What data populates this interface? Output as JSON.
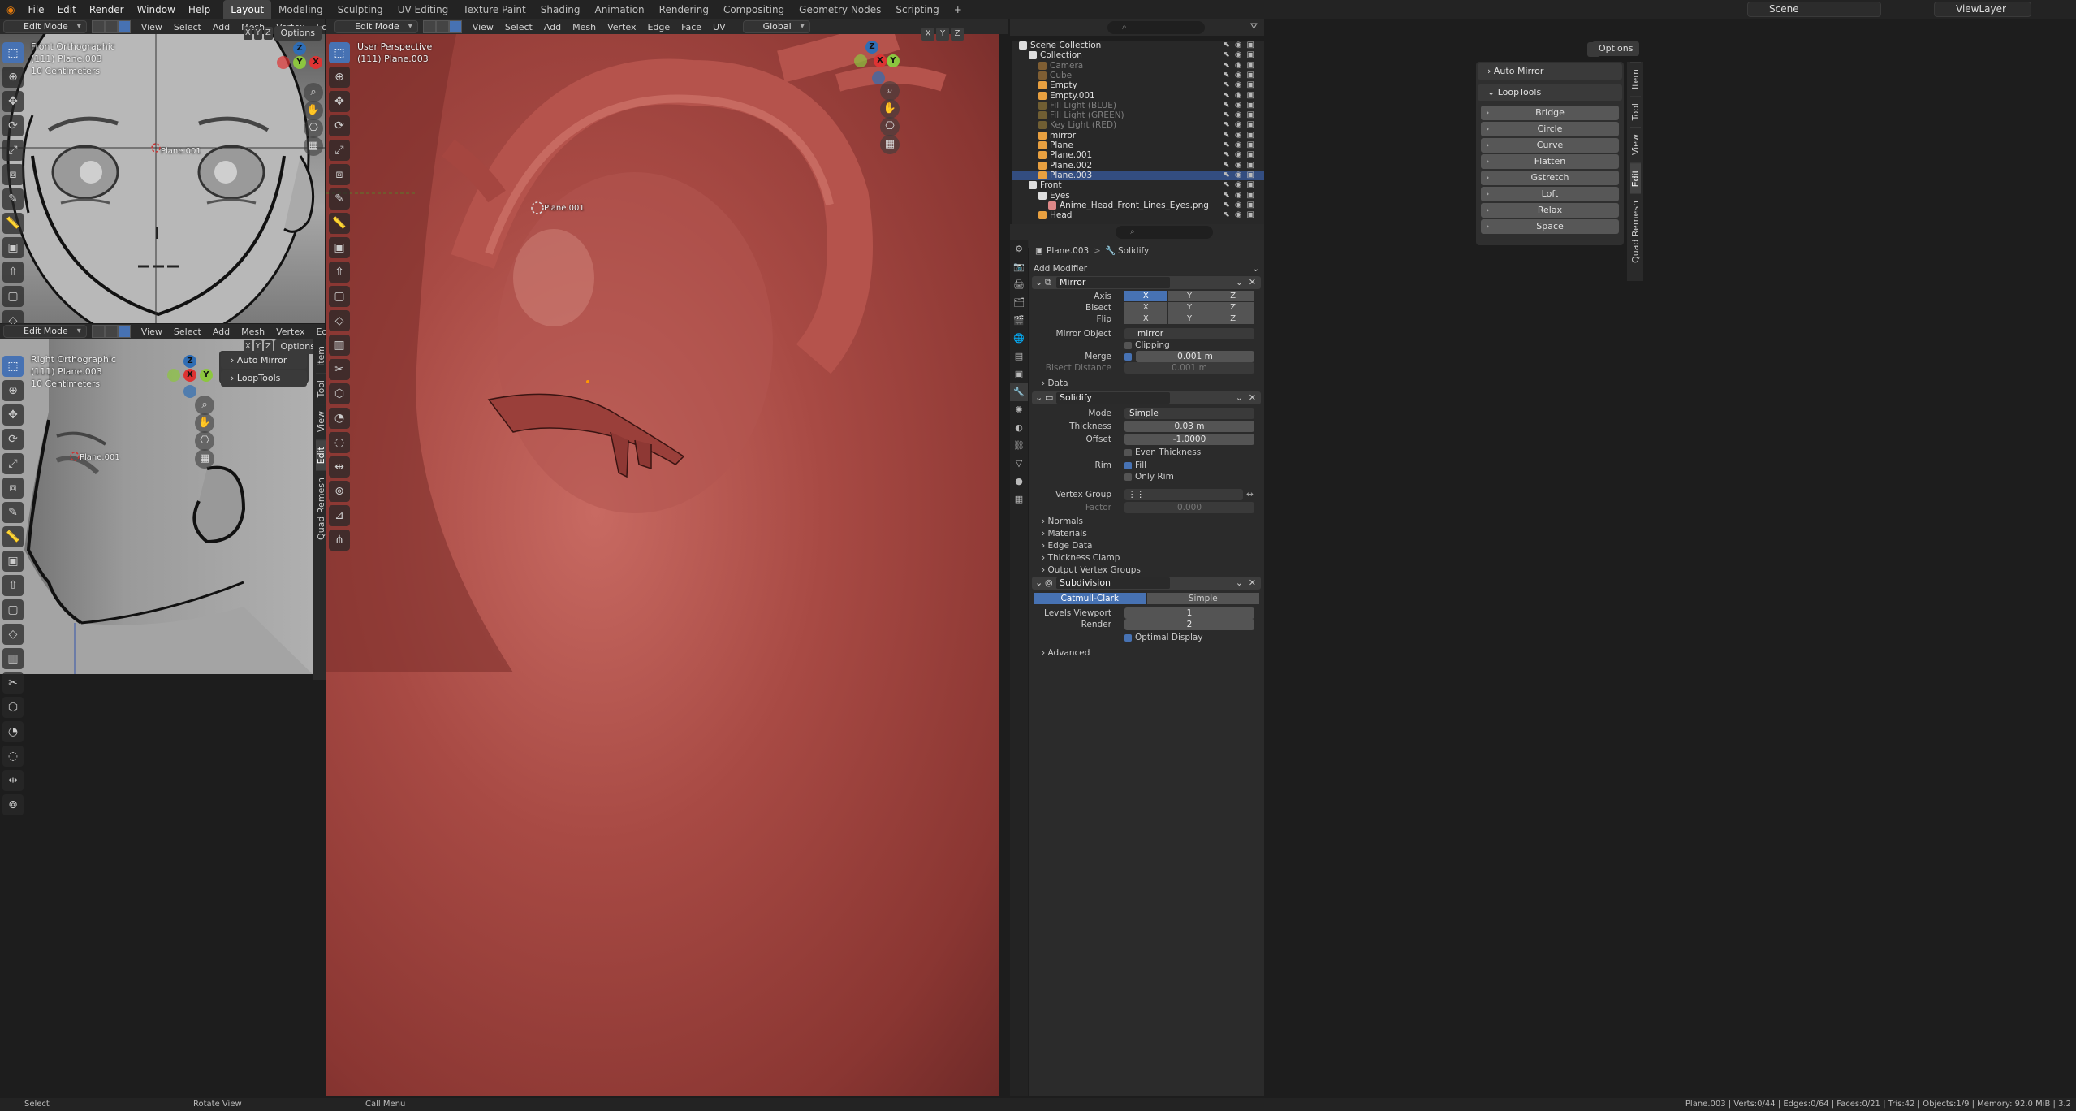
{
  "topbar": {
    "menus": [
      "File",
      "Edit",
      "Render",
      "Window",
      "Help"
    ],
    "workspaces": [
      "Layout",
      "Modeling",
      "Sculpting",
      "UV Editing",
      "Texture Paint",
      "Shading",
      "Animation",
      "Rendering",
      "Compositing",
      "Geometry Nodes",
      "Scripting"
    ],
    "active_workspace": "Layout",
    "add_tab": "+",
    "scene": "Scene",
    "view_layer": "ViewLayer"
  },
  "viewport_header": {
    "mode": "Edit Mode",
    "menus_full": [
      "View",
      "Select",
      "Add",
      "Mesh",
      "Vertex",
      "Edge",
      "Face",
      "UV"
    ],
    "transform": "Global",
    "options": "Options",
    "axes": [
      "X",
      "Y",
      "Z"
    ]
  },
  "viewport_front": {
    "line1": "Front Orthographic",
    "line2": "(111) Plane.003",
    "line3": "10 Centimeters",
    "cursor_label": "Plane.001",
    "gizmo": {
      "z": "Z",
      "y": "Y",
      "x": "X"
    }
  },
  "viewport_right": {
    "line1": "Right Orthographic",
    "line2": "(111) Plane.003",
    "line3": "10 Centimeters",
    "cursor_label": "Plane.001",
    "panel_auto_mirror": "Auto Mirror",
    "panel_looptools": "LoopTools",
    "gizmo": {
      "z": "Z",
      "y": "Y",
      "x": "X"
    }
  },
  "viewport_main": {
    "line1": "User Perspective",
    "line2": "(111) Plane.003",
    "cursor_label": "Plane.001",
    "panel_auto_mirror": "Auto Mirror",
    "panel_looptools": "LoopTools",
    "looptools_buttons": [
      "Bridge",
      "Circle",
      "Curve",
      "Flatten",
      "Gstretch",
      "Loft",
      "Relax",
      "Space"
    ],
    "gizmo": {
      "z": "Z",
      "y": "Y",
      "x": "X"
    }
  },
  "side_tabs": [
    "Item",
    "Tool",
    "View",
    "Edit",
    "Quad Remesh"
  ],
  "outliner": {
    "rows": [
      {
        "label": "Scene Collection",
        "indent": 0,
        "state": "normal"
      },
      {
        "label": "Collection",
        "indent": 1,
        "state": "normal"
      },
      {
        "label": "Camera",
        "indent": 2,
        "state": "dim"
      },
      {
        "label": "Cube",
        "indent": 2,
        "state": "dim"
      },
      {
        "label": "Empty",
        "indent": 2,
        "state": "normal"
      },
      {
        "label": "Empty.001",
        "indent": 2,
        "state": "normal"
      },
      {
        "label": "Fill Light (BLUE)",
        "indent": 2,
        "state": "dim"
      },
      {
        "label": "Fill Light (GREEN)",
        "indent": 2,
        "state": "dim"
      },
      {
        "label": "Key Light (RED)",
        "indent": 2,
        "state": "dim"
      },
      {
        "label": "mirror",
        "indent": 2,
        "state": "normal"
      },
      {
        "label": "Plane",
        "indent": 2,
        "state": "normal"
      },
      {
        "label": "Plane.001",
        "indent": 2,
        "state": "normal"
      },
      {
        "label": "Plane.002",
        "indent": 2,
        "state": "normal"
      },
      {
        "label": "Plane.003",
        "indent": 2,
        "state": "selected"
      },
      {
        "label": "Front",
        "indent": 1,
        "state": "normal"
      },
      {
        "label": "Eyes",
        "indent": 2,
        "state": "normal"
      },
      {
        "label": "Anime_Head_Front_Lines_Eyes.png",
        "indent": 3,
        "state": "normal"
      },
      {
        "label": "Head",
        "indent": 2,
        "state": "normal"
      }
    ]
  },
  "properties": {
    "breadcrumb_object": "Plane.003",
    "breadcrumb_sep": ">",
    "breadcrumb_modifier": "Solidify",
    "add_modifier": "Add Modifier",
    "mirror": {
      "name": "Mirror",
      "axis_label": "Axis",
      "bisect_label": "Bisect",
      "flip_label": "Flip",
      "axes": [
        "X",
        "Y",
        "Z"
      ],
      "mirror_object_label": "Mirror Object",
      "mirror_object": "mirror",
      "clipping": "Clipping",
      "merge_label": "Merge",
      "merge_value": "0.001 m",
      "bisect_distance_label": "Bisect Distance",
      "bisect_distance_value": "0.001 m",
      "data": "Data"
    },
    "solidify": {
      "name": "Solidify",
      "mode_label": "Mode",
      "mode": "Simple",
      "thickness_label": "Thickness",
      "thickness": "0.03 m",
      "offset_label": "Offset",
      "offset": "-1.0000",
      "even_thickness": "Even Thickness",
      "rim_label": "Rim",
      "fill": "Fill",
      "only_rim": "Only Rim",
      "vertex_group_label": "Vertex Group",
      "factor_label": "Factor",
      "factor": "0.000",
      "subpanels": [
        "Normals",
        "Materials",
        "Edge Data",
        "Thickness Clamp",
        "Output Vertex Groups"
      ]
    },
    "subdivision": {
      "name": "Subdivision",
      "algo": [
        "Catmull-Clark",
        "Simple"
      ],
      "levels_viewport_label": "Levels Viewport",
      "levels_viewport": "1",
      "render_label": "Render",
      "render": "2",
      "optimal_display": "Optimal Display",
      "advanced": "Advanced"
    }
  },
  "statusbar": {
    "select": "Select",
    "rotate": "Rotate View",
    "call_menu": "Call Menu",
    "stats": "Plane.003 | Verts:0/44 | Edges:0/64 | Faces:0/21 | Tris:42 | Objects:1/9 | Memory: 92.0 MiB | 3.2"
  },
  "colors": {
    "accent": "#4772b3",
    "skin": "#b0504a",
    "bg": "#1d1d1d"
  }
}
